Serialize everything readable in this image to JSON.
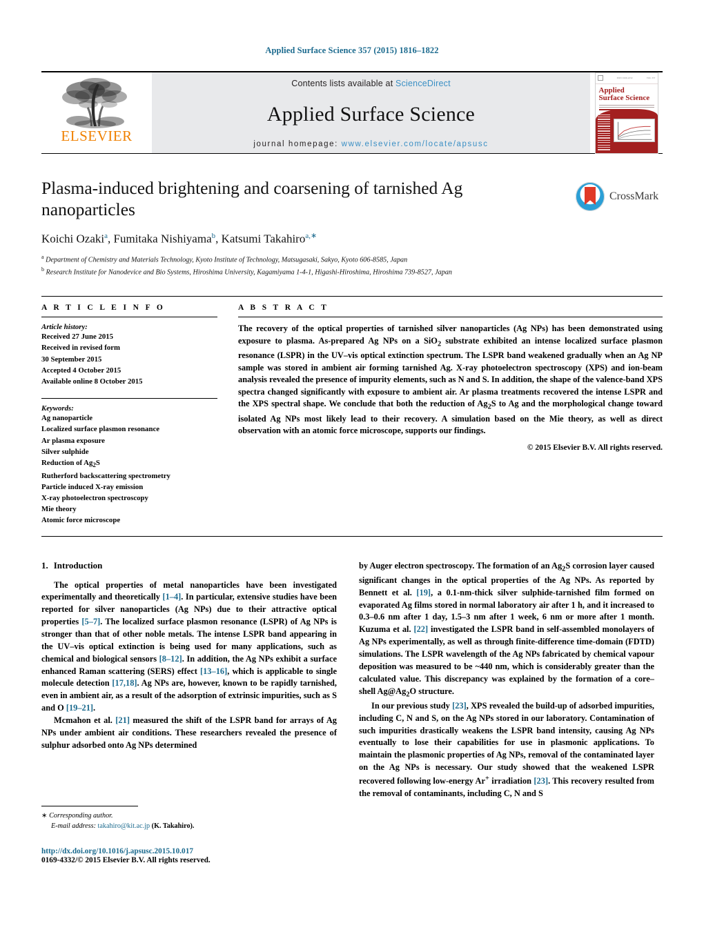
{
  "running_head": "Applied Surface Science 357 (2015) 1816–1822",
  "masthead": {
    "publisher_name": "ELSEVIER",
    "contents_prefix": "Contents lists available at ",
    "contents_link": "ScienceDirect",
    "journal_title": "Applied Surface Science",
    "homepage_prefix": "journal homepage: ",
    "homepage_url": "www.elsevier.com/locate/apsusc",
    "cover": {
      "title_line1": "Applied",
      "title_line2": "Surface Science"
    }
  },
  "crossmark": {
    "label": "CrossMark"
  },
  "article": {
    "title": "Plasma-induced brightening and coarsening of tarnished Ag nanoparticles",
    "authors_html": "Koichi Ozaki<sup>a</sup>, Fumitaka Nishiyama<sup>b</sup>, Katsumi Takahiro<sup>a,∗</sup>",
    "affiliation_a": "Department of Chemistry and Materials Technology, Kyoto Institute of Technology, Matsugasaki, Sakyo, Kyoto 606-8585, Japan",
    "affiliation_b": "Research Institute for Nanodevice and Bio Systems, Hiroshima University, Kagamiyama 1-4-1, Higashi-Hiroshima, Hiroshima 739-8527, Japan"
  },
  "article_info": {
    "heading": "A R T I C L E    I N F O",
    "history_title": "Article history:",
    "history": [
      "Received 27 June 2015",
      "Received in revised form",
      "30 September 2015",
      "Accepted 4 October 2015",
      "Available online 8 October 2015"
    ],
    "keywords_title": "Keywords:",
    "keywords": [
      "Ag nanoparticle",
      "Localized surface plasmon resonance",
      "Ar plasma exposure",
      "Silver sulphide",
      "Reduction of Ag2S",
      "Rutherford backscattering spectrometry",
      "Particle induced X-ray emission",
      "X-ray photoelectron spectroscopy",
      "Mie theory",
      "Atomic force microscope"
    ]
  },
  "abstract": {
    "heading": "A B S T R A C T",
    "text": "The recovery of the optical properties of tarnished silver nanoparticles (Ag NPs) has been demonstrated using exposure to plasma. As-prepared Ag NPs on a SiO2 substrate exhibited an intense localized surface plasmon resonance (LSPR) in the UV–vis optical extinction spectrum. The LSPR band weakened gradually when an Ag NP sample was stored in ambient air forming tarnished Ag. X-ray photoelectron spectroscopy (XPS) and ion-beam analysis revealed the presence of impurity elements, such as N and S. In addition, the shape of the valence-band XPS spectra changed significantly with exposure to ambient air. Ar plasma treatments recovered the intense LSPR and the XPS spectral shape. We conclude that both the reduction of Ag2S to Ag and the morphological change toward isolated Ag NPs most likely lead to their recovery. A simulation based on the Mie theory, as well as direct observation with an atomic force microscope, supports our findings.",
    "copyright": "© 2015 Elsevier B.V. All rights reserved."
  },
  "introduction": {
    "heading_number": "1.",
    "heading_text": "Introduction",
    "left_paragraphs": [
      "The optical properties of metal nanoparticles have been investigated experimentally and theoretically [1–4]. In particular, extensive studies have been reported for silver nanoparticles (Ag NPs) due to their attractive optical properties [5–7]. The localized surface plasmon resonance (LSPR) of Ag NPs is stronger than that of other noble metals. The intense LSPR band appearing in the UV–vis optical extinction is being used for many applications, such as chemical and biological sensors [8–12]. In addition, the Ag NPs exhibit a surface enhanced Raman scattering (SERS) effect [13–16], which is applicable to single molecule detection [17,18]. Ag NPs are, however, known to be rapidly tarnished, even in ambient air, as a result of the adsorption of extrinsic impurities, such as S and O [19–21].",
      "Mcmahon et al. [21] measured the shift of the LSPR band for arrays of Ag NPs under ambient air conditions. These researchers revealed the presence of sulphur adsorbed onto Ag NPs determined"
    ],
    "right_paragraphs": [
      "by Auger electron spectroscopy. The formation of an Ag2S corrosion layer caused significant changes in the optical properties of the Ag NPs. As reported by Bennett et al. [19], a 0.1-nm-thick silver sulphide-tarnished film formed on evaporated Ag films stored in normal laboratory air after 1 h, and it increased to 0.3–0.6 nm after 1 day, 1.5–3 nm after 1 week, 6 nm or more after 1 month. Kuzuma et al. [22] investigated the LSPR band in self-assembled monolayers of Ag NPs experimentally, as well as through finite-difference time-domain (FDTD) simulations. The LSPR wavelength of the Ag NPs fabricated by chemical vapour deposition was measured to be ~440 nm, which is considerably greater than the calculated value. This discrepancy was explained by the formation of a core–shell Ag@Ag2O structure.",
      "In our previous study [23], XPS revealed the build-up of adsorbed impurities, including C, N and S, on the Ag NPs stored in our laboratory. Contamination of such impurities drastically weakens the LSPR band intensity, causing Ag NPs eventually to lose their capabilities for use in plasmonic applications. To maintain the plasmonic properties of Ag NPs, removal of the contaminated layer on the Ag NPs is necessary. Our study showed that the weakened LSPR recovered following low-energy Ar+ irradiation [23]. This recovery resulted from the removal of contaminants, including C, N and S"
    ]
  },
  "footer": {
    "corresponding_marker": "∗",
    "corresponding_label": "Corresponding author.",
    "email_label": "E-mail address:",
    "email": "takahiro@kit.ac.jp",
    "email_owner": "(K. Takahiro).",
    "doi": "http://dx.doi.org/10.1016/j.apsusc.2015.10.017",
    "issn_line": "0169-4332/© 2015 Elsevier B.V. All rights reserved."
  },
  "colors": {
    "link": "#1b6a8e",
    "elsevier_orange": "#f08000",
    "band_gray": "#e8e9eb",
    "cover_red": "#a32020"
  }
}
